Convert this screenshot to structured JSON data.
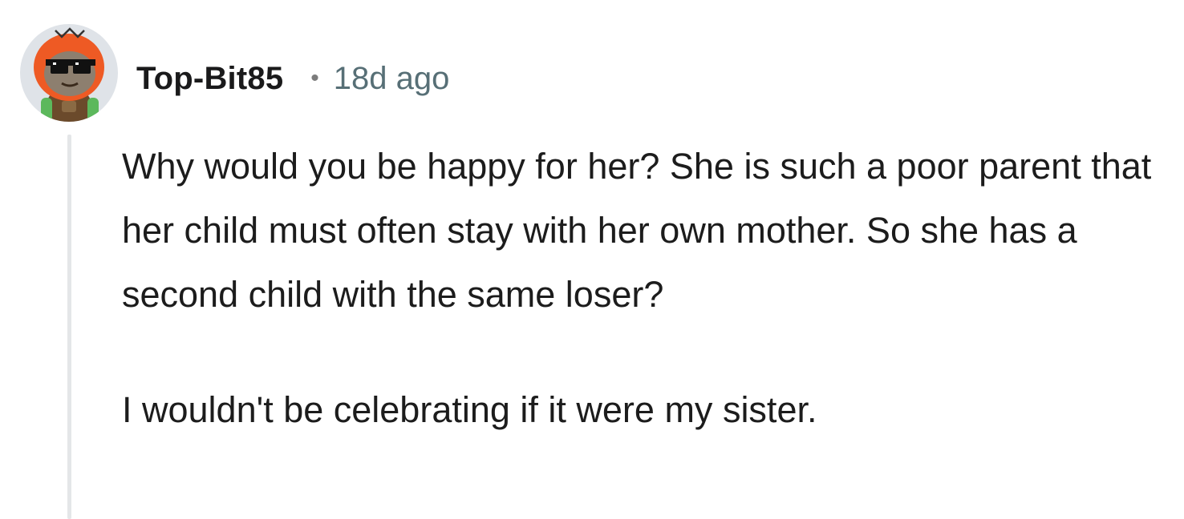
{
  "comment": {
    "author": "Top-Bit85",
    "separator": "•",
    "timestamp": "18d ago",
    "avatar_icon": "snoo-sloth-avatar-icon",
    "paragraphs": [
      "Why would you be happy for her? She is such a poor parent that her child must often stay with her own mother. So she has a second child with the same loser?",
      "I wouldn't be celebrating if it were my sister."
    ]
  },
  "colors": {
    "username": "#1a1a1b",
    "timestamp": "#576f76",
    "thread_line": "#e4e6e8",
    "avatar_bg": "#dfe3e8",
    "hood_orange": "#ee5a24"
  }
}
